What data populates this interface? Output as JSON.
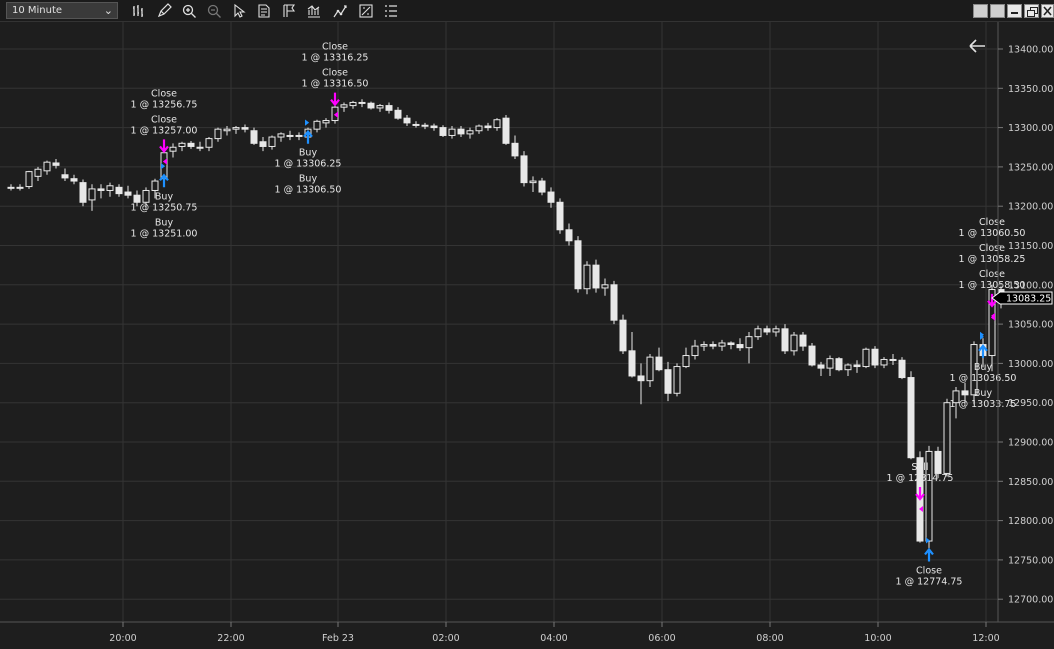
{
  "toolbar": {
    "interval": "10 Minute",
    "tools": [
      "bar-type-icon",
      "pencil-icon",
      "zoom-in-icon",
      "zoom-out-icon",
      "pointer-icon",
      "properties-icon",
      "flag-icon",
      "indicators-icon",
      "strategy-icon",
      "chart-trader-icon",
      "list-icon"
    ]
  },
  "window_buttons": [
    "tile-icon",
    "cascade-icon",
    "minimize-icon",
    "restore-icon",
    "close-icon"
  ],
  "colors": {
    "background": "#1e1e1e",
    "grid": "#343434",
    "candle": "#e8e8e8",
    "buy": "#1e90ff",
    "sell": "#ff00ff",
    "price_tag": "#ffffff"
  },
  "chart_data": {
    "type": "candlestick",
    "instrument_interval": "10 Minute",
    "ylim": [
      12675,
      13425
    ],
    "y_ticks": [
      "13400.00",
      "13350.00",
      "13300.00",
      "13250.00",
      "13200.00",
      "13150.00",
      "13100.00",
      "13050.00",
      "13000.00",
      "12950.00",
      "12900.00",
      "12850.00",
      "12800.00",
      "12750.00",
      "12700.00"
    ],
    "x_ticks": [
      "20:00",
      "22:00",
      "Feb 23",
      "02:00",
      "04:00",
      "06:00",
      "08:00",
      "10:00",
      "12:00"
    ],
    "last_price": "13083.25",
    "candles": [
      [
        13223,
        13228,
        13220,
        13224
      ],
      [
        13224,
        13228,
        13220,
        13224
      ],
      [
        13225,
        13245,
        13222,
        13244
      ],
      [
        13238,
        13250,
        13232,
        13247
      ],
      [
        13245,
        13258,
        13240,
        13256
      ],
      [
        13255,
        13260,
        13248,
        13252
      ],
      [
        13240,
        13248,
        13232,
        13236
      ],
      [
        13235,
        13240,
        13228,
        13232
      ],
      [
        13230,
        13234,
        13200,
        13205
      ],
      [
        13208,
        13228,
        13194,
        13222
      ],
      [
        13222,
        13228,
        13210,
        13220
      ],
      [
        13220,
        13230,
        13212,
        13226
      ],
      [
        13224,
        13228,
        13212,
        13216
      ],
      [
        13218,
        13226,
        13210,
        13214
      ],
      [
        13214,
        13220,
        13200,
        13205
      ],
      [
        13205,
        13224,
        13198,
        13220
      ],
      [
        13220,
        13235,
        13210,
        13232
      ],
      [
        13235,
        13270,
        13232,
        13268
      ],
      [
        13270,
        13280,
        13262,
        13275
      ],
      [
        13276,
        13282,
        13270,
        13280
      ],
      [
        13280,
        13283,
        13273,
        13276
      ],
      [
        13274,
        13282,
        13270,
        13275
      ],
      [
        13275,
        13288,
        13270,
        13286
      ],
      [
        13286,
        13300,
        13282,
        13298
      ],
      [
        13296,
        13302,
        13290,
        13298
      ],
      [
        13298,
        13302,
        13292,
        13300
      ],
      [
        13300,
        13304,
        13294,
        13298
      ],
      [
        13296,
        13300,
        13278,
        13280
      ],
      [
        13282,
        13288,
        13270,
        13276
      ],
      [
        13276,
        13290,
        13272,
        13288
      ],
      [
        13288,
        13294,
        13282,
        13292
      ],
      [
        13290,
        13296,
        13284,
        13290
      ],
      [
        13290,
        13294,
        13284,
        13289
      ],
      [
        13288,
        13300,
        13286,
        13298
      ],
      [
        13298,
        13310,
        13294,
        13308
      ],
      [
        13306,
        13312,
        13300,
        13309
      ],
      [
        13309,
        13330,
        13305,
        13326
      ],
      [
        13326,
        13332,
        13320,
        13329
      ],
      [
        13328,
        13334,
        13324,
        13332
      ],
      [
        13332,
        13336,
        13326,
        13331
      ],
      [
        13331,
        13333,
        13323,
        13325
      ],
      [
        13325,
        13330,
        13320,
        13328
      ],
      [
        13328,
        13332,
        13318,
        13322
      ],
      [
        13322,
        13326,
        13310,
        13312
      ],
      [
        13312,
        13316,
        13302,
        13306
      ],
      [
        13304,
        13308,
        13300,
        13303
      ],
      [
        13303,
        13306,
        13298,
        13302
      ],
      [
        13302,
        13305,
        13296,
        13300
      ],
      [
        13300,
        13303,
        13288,
        13290
      ],
      [
        13290,
        13302,
        13286,
        13298
      ],
      [
        13298,
        13302,
        13288,
        13292
      ],
      [
        13292,
        13300,
        13286,
        13296
      ],
      [
        13296,
        13304,
        13292,
        13302
      ],
      [
        13302,
        13306,
        13296,
        13300
      ],
      [
        13300,
        13312,
        13296,
        13310
      ],
      [
        13312,
        13316,
        13278,
        13280
      ],
      [
        13280,
        13290,
        13260,
        13264
      ],
      [
        13264,
        13270,
        13225,
        13230
      ],
      [
        13230,
        13238,
        13218,
        13232
      ],
      [
        13232,
        13236,
        13214,
        13218
      ],
      [
        13218,
        13224,
        13198,
        13205
      ],
      [
        13205,
        13210,
        13165,
        13170
      ],
      [
        13170,
        13178,
        13150,
        13156
      ],
      [
        13156,
        13162,
        13090,
        13095
      ],
      [
        13095,
        13130,
        13088,
        13125
      ],
      [
        13125,
        13132,
        13090,
        13096
      ],
      [
        13096,
        13108,
        13086,
        13100
      ],
      [
        13100,
        13105,
        13050,
        13055
      ],
      [
        13055,
        13062,
        13012,
        13016
      ],
      [
        13016,
        13040,
        12982,
        12984
      ],
      [
        12984,
        13000,
        12948,
        12978
      ],
      [
        12978,
        13012,
        12970,
        13008
      ],
      [
        13008,
        13020,
        12990,
        12992
      ],
      [
        12992,
        13002,
        12952,
        12962
      ],
      [
        12962,
        13000,
        12958,
        12996
      ],
      [
        12996,
        13020,
        12994,
        13010
      ],
      [
        13010,
        13030,
        13005,
        13022
      ],
      [
        13022,
        13028,
        13016,
        13024
      ],
      [
        13024,
        13028,
        13018,
        13022
      ],
      [
        13022,
        13030,
        13016,
        13026
      ],
      [
        13026,
        13028,
        13018,
        13024
      ],
      [
        13024,
        13032,
        13016,
        13020
      ],
      [
        13020,
        13040,
        13000,
        13034
      ],
      [
        13034,
        13048,
        13030,
        13044
      ],
      [
        13044,
        13048,
        13036,
        13040
      ],
      [
        13040,
        13048,
        13034,
        13044
      ],
      [
        13044,
        13050,
        13012,
        13016
      ],
      [
        13016,
        13040,
        13010,
        13036
      ],
      [
        13036,
        13040,
        13016,
        13022
      ],
      [
        13022,
        13026,
        12996,
        12998
      ],
      [
        12998,
        13002,
        12984,
        12994
      ],
      [
        12994,
        13010,
        12984,
        13006
      ],
      [
        13006,
        13008,
        12990,
        12992
      ],
      [
        12992,
        13000,
        12984,
        12998
      ],
      [
        12998,
        13004,
        12988,
        12996
      ],
      [
        12996,
        13020,
        12994,
        13018
      ],
      [
        13018,
        13022,
        12994,
        12998
      ],
      [
        12998,
        13008,
        12994,
        13005
      ],
      [
        13005,
        13012,
        12998,
        13004
      ],
      [
        13004,
        13008,
        12980,
        12982
      ],
      [
        12982,
        12990,
        12878,
        12880
      ],
      [
        12880,
        12888,
        12772,
        12774
      ],
      [
        12774,
        12895,
        12765,
        12888
      ],
      [
        12888,
        12894,
        12854,
        12860
      ],
      [
        12860,
        12955,
        12856,
        12950
      ],
      [
        12950,
        12970,
        12930,
        12965
      ],
      [
        12965,
        12975,
        12950,
        12960
      ],
      [
        12960,
        13028,
        12948,
        13024
      ],
      [
        13024,
        13032,
        12995,
        13010
      ],
      [
        13010,
        13100,
        12990,
        13094
      ],
      [
        13094,
        13098,
        13070,
        13083
      ]
    ],
    "trades": [
      {
        "type": "Close",
        "label": "Close",
        "detail": "1 @ 13256.75",
        "price": 13256.75,
        "bar": 17,
        "arrow": "down"
      },
      {
        "type": "Close",
        "label": "Close",
        "detail": "1 @ 13257.00",
        "price": 13257.0,
        "bar": 17,
        "arrow": "down"
      },
      {
        "type": "Buy",
        "label": "Buy",
        "detail": "1 @ 13250.75",
        "price": 13250.75,
        "bar": 17,
        "arrow": "up"
      },
      {
        "type": "Buy",
        "label": "Buy",
        "detail": "1 @ 13251.00",
        "price": 13251.0,
        "bar": 17,
        "arrow": "up"
      },
      {
        "type": "Close",
        "label": "Close",
        "detail": "1 @ 13316.25",
        "price": 13316.25,
        "bar": 36,
        "arrow": "down"
      },
      {
        "type": "Close",
        "label": "Close",
        "detail": "1 @ 13316.50",
        "price": 13316.5,
        "bar": 36,
        "arrow": "down"
      },
      {
        "type": "Buy",
        "label": "Buy",
        "detail": "1 @ 13306.25",
        "price": 13306.25,
        "bar": 33,
        "arrow": "up"
      },
      {
        "type": "Buy",
        "label": "Buy",
        "detail": "1 @ 13306.50",
        "price": 13306.5,
        "bar": 33,
        "arrow": "up"
      },
      {
        "type": "Sell",
        "label": "Sell",
        "detail": "1 @ 12814.75",
        "price": 12814.75,
        "bar": 101,
        "arrow": "down"
      },
      {
        "type": "Close",
        "label": "Close",
        "detail": "1 @ 12774.75",
        "price": 12774.75,
        "bar": 102,
        "arrow": "up"
      },
      {
        "type": "Buy",
        "label": "Buy",
        "detail": "1 @ 13036.50",
        "price": 13036.5,
        "bar": 108,
        "arrow": "up"
      },
      {
        "type": "Buy",
        "label": "Buy",
        "detail": "1 @ 13033.75",
        "price": 13033.75,
        "bar": 108,
        "arrow": "up"
      },
      {
        "type": "Close",
        "label": "Close",
        "detail": "1 @ 13060.50",
        "price": 13060.5,
        "bar": 109,
        "arrow": "down"
      },
      {
        "type": "Close",
        "label": "Close",
        "detail": "1 @ 13058.25",
        "price": 13058.25,
        "bar": 109,
        "arrow": "down"
      },
      {
        "type": "Close",
        "label": "Close",
        "detail": "1 @ 13058.50",
        "price": 13058.5,
        "bar": 109,
        "arrow": "down"
      }
    ]
  }
}
